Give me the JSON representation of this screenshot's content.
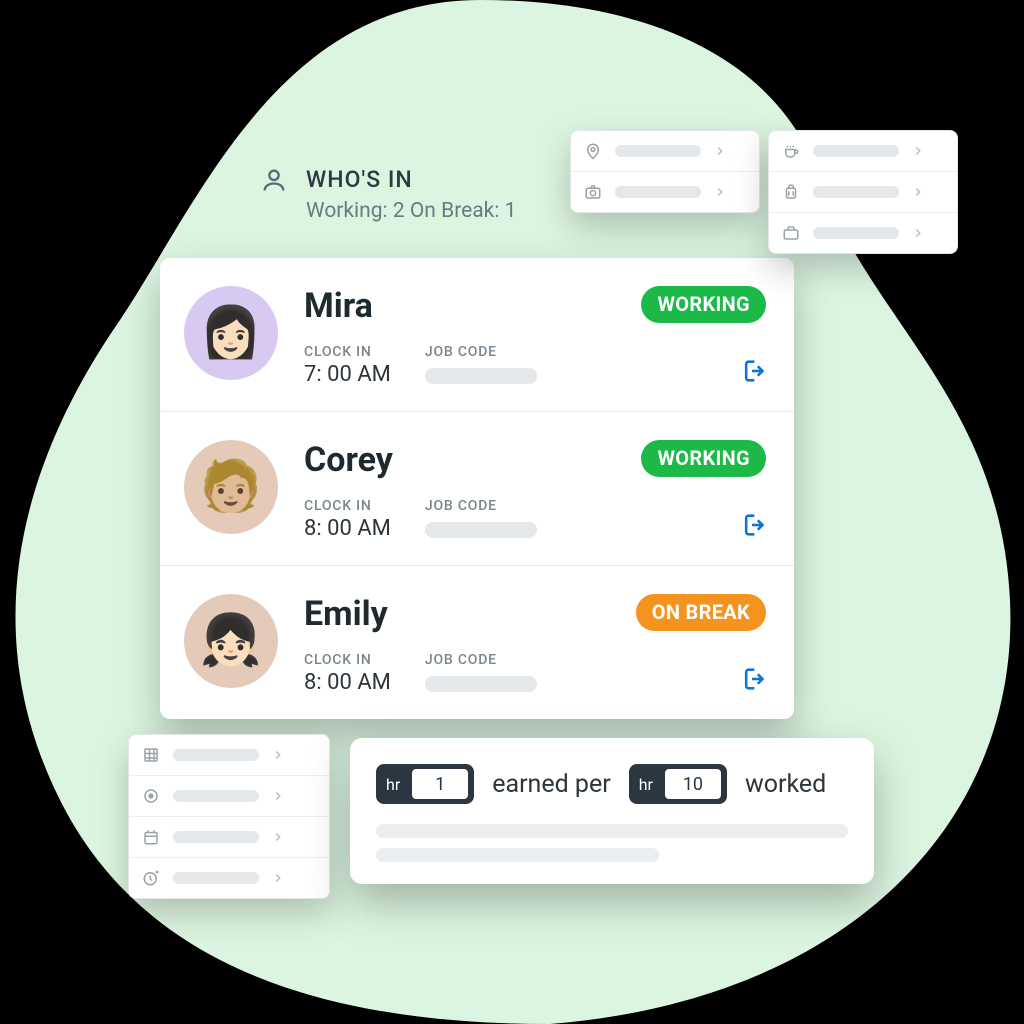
{
  "header": {
    "title": "WHO'S IN",
    "working_count": 2,
    "break_count": 1,
    "counts_display": "Working: 2  On Break: 1"
  },
  "labels": {
    "clock_in": "CLOCK IN",
    "job_code": "JOB CODE",
    "status_working": "WORKING",
    "status_break": "ON BREAK"
  },
  "employees": [
    {
      "name": "Mira",
      "clock_in": "7: 00 AM",
      "status": "working",
      "avatar_class": "av-mira",
      "face": "👩🏻"
    },
    {
      "name": "Corey",
      "clock_in": "8: 00 AM",
      "status": "working",
      "avatar_class": "av-corey",
      "face": "🧑🏼"
    },
    {
      "name": "Emily",
      "clock_in": "8: 00 AM",
      "status": "break",
      "avatar_class": "av-emily",
      "face": "👧🏻"
    }
  ],
  "popovers": {
    "top_left": {
      "items": [
        "location",
        "camera"
      ]
    },
    "top_right": {
      "items": [
        "coffee",
        "luggage",
        "briefcase"
      ]
    },
    "bot_left": {
      "items": [
        "grid",
        "target",
        "calendar",
        "add-time"
      ]
    }
  },
  "accrual": {
    "unit": "hr",
    "earned_value": "1",
    "earned_label": "earned per",
    "worked_value": "10",
    "worked_label": "worked"
  }
}
